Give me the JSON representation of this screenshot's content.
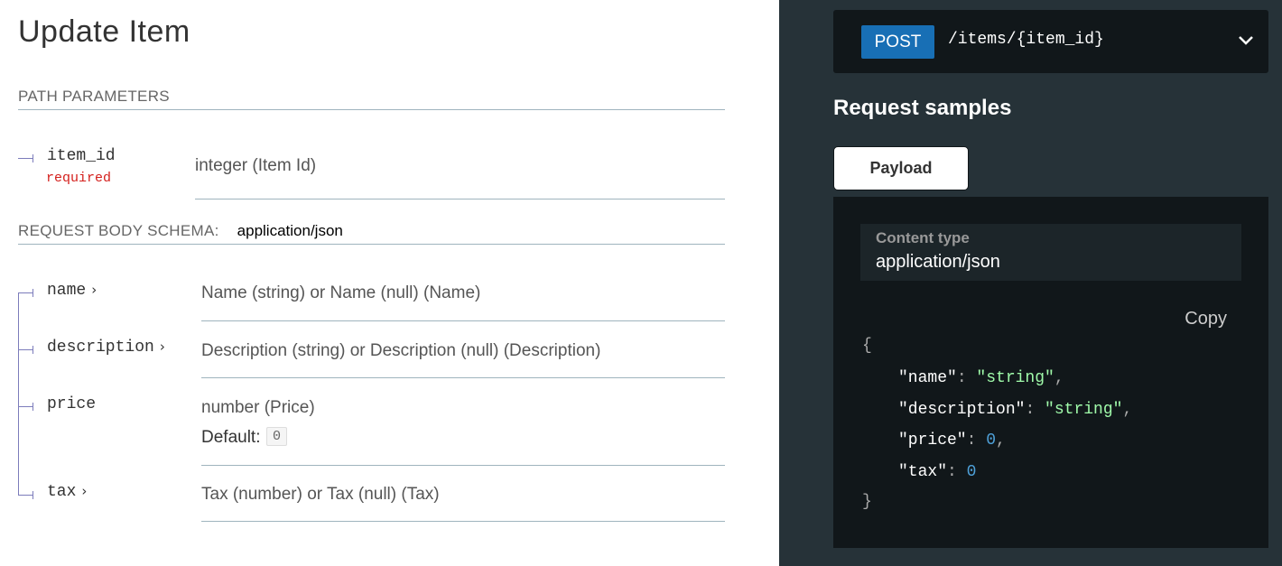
{
  "title": "Update Item",
  "path_parameters": {
    "heading": "PATH PARAMETERS",
    "params": [
      {
        "name": "item_id",
        "required": "required",
        "type": "integer (Item Id)"
      }
    ]
  },
  "request_body": {
    "heading": "REQUEST BODY SCHEMA:",
    "media_type": "application/json",
    "fields": [
      {
        "name": "name",
        "type": "Name (string) or Name (null) (Name)"
      },
      {
        "name": "description",
        "type": "Description (string) or Description (null) (Description)"
      },
      {
        "name": "price",
        "type": "number (Price)",
        "default_label": "Default:",
        "default_value": "0"
      },
      {
        "name": "tax",
        "type": "Tax (number) or Tax (null) (Tax)"
      }
    ]
  },
  "endpoint": {
    "method": "POST",
    "path": "/items/{item_id}",
    "method_color": "#186fb5"
  },
  "samples": {
    "title": "Request samples",
    "tab_label": "Payload",
    "content_type_label": "Content type",
    "content_type_value": "application/json",
    "copy_label": "Copy",
    "code": {
      "open": "{",
      "lines": [
        {
          "key": "\"name\"",
          "value": "\"string\"",
          "kind": "string",
          "trail": ","
        },
        {
          "key": "\"description\"",
          "value": "\"string\"",
          "kind": "string",
          "trail": ","
        },
        {
          "key": "\"price\"",
          "value": "0",
          "kind": "number",
          "trail": ","
        },
        {
          "key": "\"tax\"",
          "value": "0",
          "kind": "number",
          "trail": ""
        }
      ],
      "close": "}"
    }
  },
  "colors": {
    "panel_bg": "#263238",
    "code_bg": "#11171a",
    "string": "#a0fbaa",
    "number": "#4ea0d8",
    "required": "#d41f1c"
  }
}
